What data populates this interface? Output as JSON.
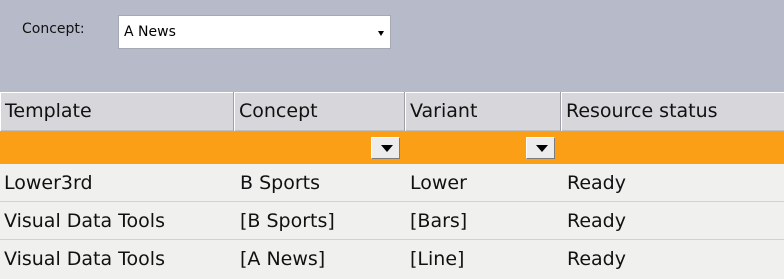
{
  "filter_bar": {
    "concept_label": "Concept:",
    "concept_value": "A News"
  },
  "grid": {
    "columns": [
      "Template",
      "Concept",
      "Variant",
      "Resource status"
    ],
    "rows": [
      {
        "template": "Lower3rd",
        "concept": "B Sports",
        "variant": "Lower",
        "status": "Ready"
      },
      {
        "template": "Visual Data Tools",
        "concept": "[B Sports]",
        "variant": "[Bars]",
        "status": "Ready"
      },
      {
        "template": "Visual Data Tools",
        "concept": "[A News]",
        "variant": "[Line]",
        "status": "Ready"
      }
    ]
  },
  "colors": {
    "top_bar": "#b7bac9",
    "filter_row": "#fb9f16",
    "grid_background": "#f0f1ee"
  },
  "icons": {
    "concept_dropdown": "chevron-down-icon",
    "column_filter_dropdown": "chevron-down-icon"
  }
}
